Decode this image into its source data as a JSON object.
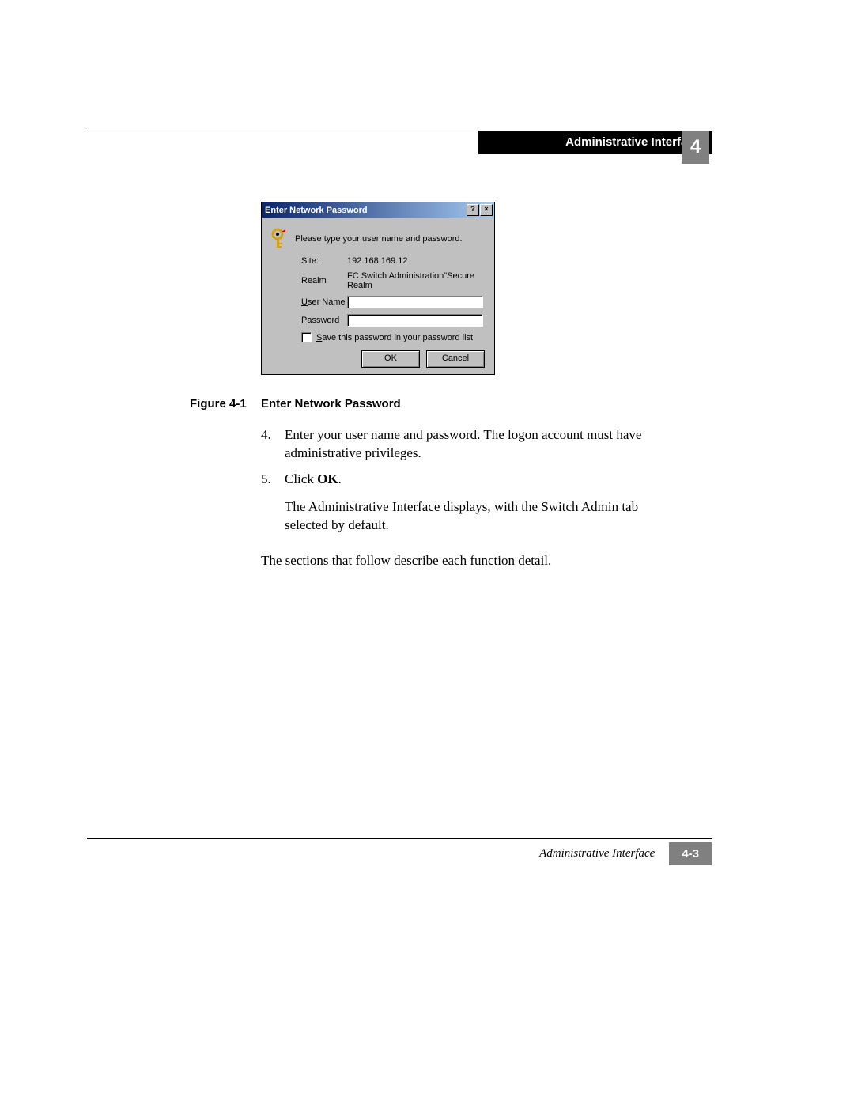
{
  "header": {
    "section_title": "Administrative Interface",
    "chapter_number": "4"
  },
  "dialog": {
    "title": "Enter Network Password",
    "help_btn": "?",
    "close_btn": "×",
    "intro": "Please type your user name and password.",
    "site_label": "Site:",
    "site_value": "192.168.169.12",
    "realm_label": "Realm",
    "realm_value": "FC Switch Administration\"Secure Realm",
    "username_u": "U",
    "username_rest": "ser Name",
    "password_u": "P",
    "password_rest": "assword",
    "save_u": "S",
    "save_rest": "ave this password in your password list",
    "ok": "OK",
    "cancel": "Cancel"
  },
  "figure": {
    "number": "Figure 4-1",
    "title": "Enter Network Password"
  },
  "content": {
    "step4_num": "4.",
    "step4_text": "Enter your user name and password. The logon account must have administrative privileges.",
    "step5_num": "5.",
    "step5_prefix": "Click ",
    "step5_bold": "OK",
    "step5_suffix": ".",
    "after5": "The Administrative Interface displays, with the Switch Admin tab selected by default.",
    "closing": "The sections that follow describe each function detail."
  },
  "footer": {
    "title": "Administrative Interface",
    "page": "4-3"
  }
}
